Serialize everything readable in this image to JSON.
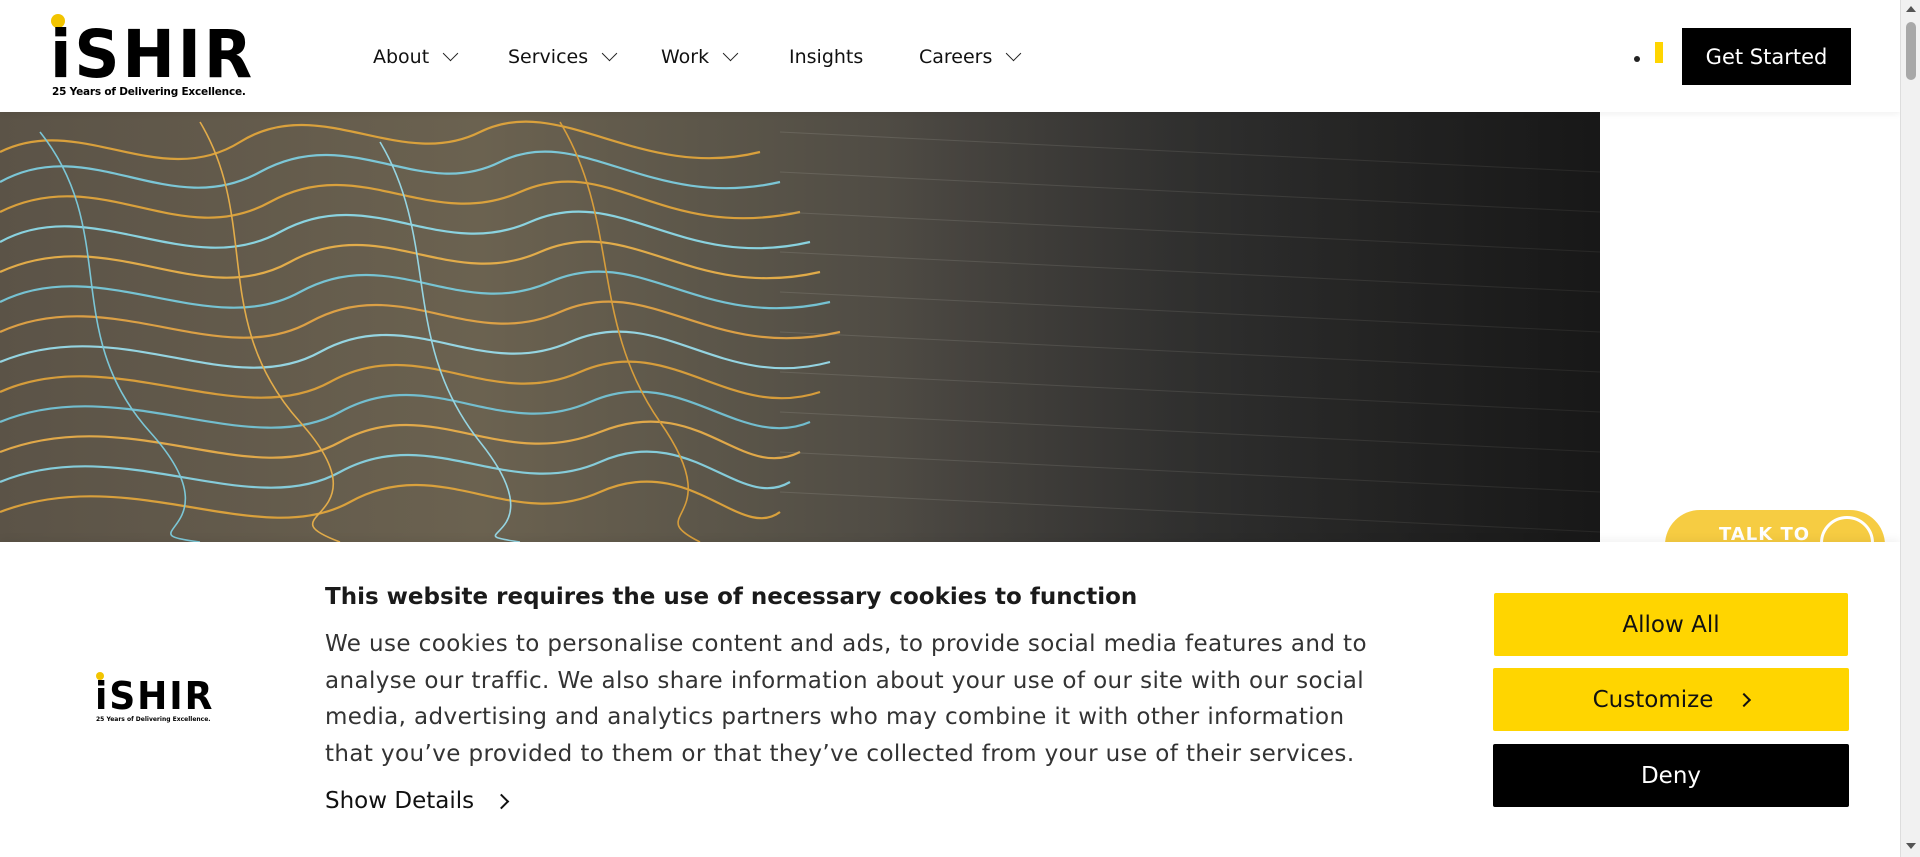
{
  "header": {
    "logo_word": "iSHIR",
    "logo_tagline": "25 Years of Delivering Excellence.",
    "nav": [
      {
        "label": "About",
        "has_dropdown": true
      },
      {
        "label": "Services",
        "has_dropdown": true
      },
      {
        "label": "Work",
        "has_dropdown": true
      },
      {
        "label": "Insights",
        "has_dropdown": false
      },
      {
        "label": "Careers",
        "has_dropdown": true
      }
    ],
    "cta_label": "Get Started"
  },
  "talk_widget": {
    "label": "TALK TO"
  },
  "cookie_banner": {
    "logo_word": "iSHIR",
    "logo_tagline": "25 Years of Delivering Excellence.",
    "title": "This website requires the use of necessary cookies to function",
    "body": "We use cookies to personalise content and ads, to provide social media features and to analyse our traffic. We also share information about your use of our site with our social media, advertising and analytics partners who may combine it with other information that you’ve provided to them or that they’ve collected from your use of their services.",
    "show_details_label": "Show Details",
    "allow_all_label": "Allow All",
    "customize_label": "Customize",
    "deny_label": "Deny"
  },
  "colors": {
    "accent_yellow": "#ffd500",
    "logo_dot": "#f2c400",
    "button_black": "#000000"
  }
}
